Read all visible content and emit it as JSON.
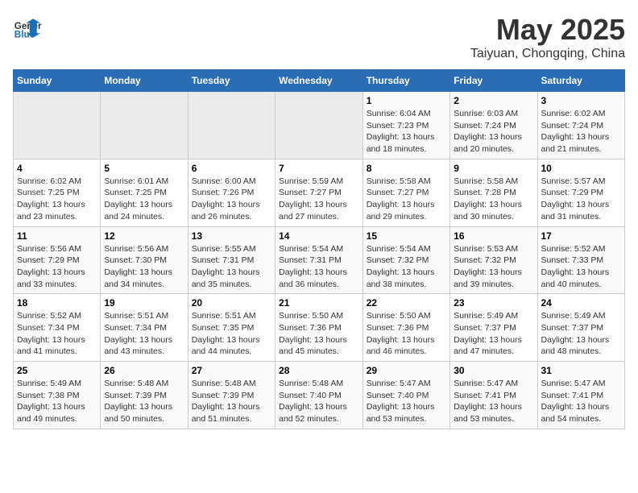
{
  "header": {
    "logo_general": "General",
    "logo_blue": "Blue",
    "month": "May 2025",
    "location": "Taiyuan, Chongqing, China"
  },
  "weekdays": [
    "Sunday",
    "Monday",
    "Tuesday",
    "Wednesday",
    "Thursday",
    "Friday",
    "Saturday"
  ],
  "weeks": [
    [
      {
        "day": "",
        "empty": true
      },
      {
        "day": "",
        "empty": true
      },
      {
        "day": "",
        "empty": true
      },
      {
        "day": "",
        "empty": true
      },
      {
        "day": "1",
        "sunrise": "6:04 AM",
        "sunset": "7:23 PM",
        "daylight": "13 hours and 18 minutes."
      },
      {
        "day": "2",
        "sunrise": "6:03 AM",
        "sunset": "7:24 PM",
        "daylight": "13 hours and 20 minutes."
      },
      {
        "day": "3",
        "sunrise": "6:02 AM",
        "sunset": "7:24 PM",
        "daylight": "13 hours and 21 minutes."
      }
    ],
    [
      {
        "day": "4",
        "sunrise": "6:02 AM",
        "sunset": "7:25 PM",
        "daylight": "13 hours and 23 minutes."
      },
      {
        "day": "5",
        "sunrise": "6:01 AM",
        "sunset": "7:25 PM",
        "daylight": "13 hours and 24 minutes."
      },
      {
        "day": "6",
        "sunrise": "6:00 AM",
        "sunset": "7:26 PM",
        "daylight": "13 hours and 26 minutes."
      },
      {
        "day": "7",
        "sunrise": "5:59 AM",
        "sunset": "7:27 PM",
        "daylight": "13 hours and 27 minutes."
      },
      {
        "day": "8",
        "sunrise": "5:58 AM",
        "sunset": "7:27 PM",
        "daylight": "13 hours and 29 minutes."
      },
      {
        "day": "9",
        "sunrise": "5:58 AM",
        "sunset": "7:28 PM",
        "daylight": "13 hours and 30 minutes."
      },
      {
        "day": "10",
        "sunrise": "5:57 AM",
        "sunset": "7:29 PM",
        "daylight": "13 hours and 31 minutes."
      }
    ],
    [
      {
        "day": "11",
        "sunrise": "5:56 AM",
        "sunset": "7:29 PM",
        "daylight": "13 hours and 33 minutes."
      },
      {
        "day": "12",
        "sunrise": "5:56 AM",
        "sunset": "7:30 PM",
        "daylight": "13 hours and 34 minutes."
      },
      {
        "day": "13",
        "sunrise": "5:55 AM",
        "sunset": "7:31 PM",
        "daylight": "13 hours and 35 minutes."
      },
      {
        "day": "14",
        "sunrise": "5:54 AM",
        "sunset": "7:31 PM",
        "daylight": "13 hours and 36 minutes."
      },
      {
        "day": "15",
        "sunrise": "5:54 AM",
        "sunset": "7:32 PM",
        "daylight": "13 hours and 38 minutes."
      },
      {
        "day": "16",
        "sunrise": "5:53 AM",
        "sunset": "7:32 PM",
        "daylight": "13 hours and 39 minutes."
      },
      {
        "day": "17",
        "sunrise": "5:52 AM",
        "sunset": "7:33 PM",
        "daylight": "13 hours and 40 minutes."
      }
    ],
    [
      {
        "day": "18",
        "sunrise": "5:52 AM",
        "sunset": "7:34 PM",
        "daylight": "13 hours and 41 minutes."
      },
      {
        "day": "19",
        "sunrise": "5:51 AM",
        "sunset": "7:34 PM",
        "daylight": "13 hours and 43 minutes."
      },
      {
        "day": "20",
        "sunrise": "5:51 AM",
        "sunset": "7:35 PM",
        "daylight": "13 hours and 44 minutes."
      },
      {
        "day": "21",
        "sunrise": "5:50 AM",
        "sunset": "7:36 PM",
        "daylight": "13 hours and 45 minutes."
      },
      {
        "day": "22",
        "sunrise": "5:50 AM",
        "sunset": "7:36 PM",
        "daylight": "13 hours and 46 minutes."
      },
      {
        "day": "23",
        "sunrise": "5:49 AM",
        "sunset": "7:37 PM",
        "daylight": "13 hours and 47 minutes."
      },
      {
        "day": "24",
        "sunrise": "5:49 AM",
        "sunset": "7:37 PM",
        "daylight": "13 hours and 48 minutes."
      }
    ],
    [
      {
        "day": "25",
        "sunrise": "5:49 AM",
        "sunset": "7:38 PM",
        "daylight": "13 hours and 49 minutes."
      },
      {
        "day": "26",
        "sunrise": "5:48 AM",
        "sunset": "7:39 PM",
        "daylight": "13 hours and 50 minutes."
      },
      {
        "day": "27",
        "sunrise": "5:48 AM",
        "sunset": "7:39 PM",
        "daylight": "13 hours and 51 minutes."
      },
      {
        "day": "28",
        "sunrise": "5:48 AM",
        "sunset": "7:40 PM",
        "daylight": "13 hours and 52 minutes."
      },
      {
        "day": "29",
        "sunrise": "5:47 AM",
        "sunset": "7:40 PM",
        "daylight": "13 hours and 53 minutes."
      },
      {
        "day": "30",
        "sunrise": "5:47 AM",
        "sunset": "7:41 PM",
        "daylight": "13 hours and 53 minutes."
      },
      {
        "day": "31",
        "sunrise": "5:47 AM",
        "sunset": "7:41 PM",
        "daylight": "13 hours and 54 minutes."
      }
    ]
  ]
}
